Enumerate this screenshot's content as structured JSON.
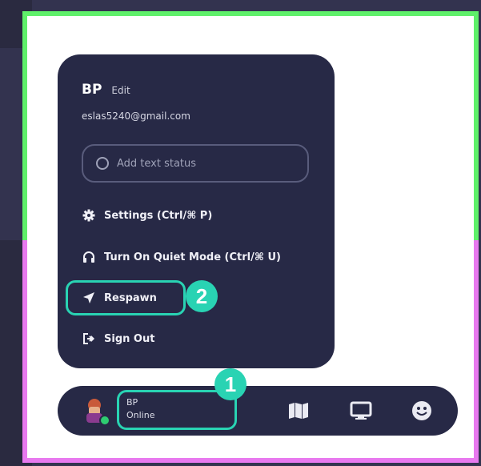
{
  "profile_menu": {
    "user_name": "BP",
    "edit_label": "Edit",
    "email": "eslas5240@gmail.com",
    "status_placeholder": "Add text status",
    "items": [
      {
        "label": "Settings (Ctrl/⌘ P)",
        "icon": "gear-icon"
      },
      {
        "label": "Turn On Quiet Mode (Ctrl/⌘ U)",
        "icon": "headphones-icon"
      },
      {
        "label": "Respawn",
        "icon": "location-arrow-icon"
      },
      {
        "label": "Sign Out",
        "icon": "sign-out-icon"
      }
    ]
  },
  "bottom_bar": {
    "user_name": "BP",
    "status": "Online",
    "icons": [
      "map-icon",
      "screen-share-icon",
      "emoji-icon"
    ]
  },
  "annotations": {
    "step_1": "1",
    "step_2": "2"
  },
  "colors": {
    "panel_bg": "#272946",
    "highlight": "#29d3b3",
    "frame_top": "#5ff06a",
    "frame_bottom": "#e879ef",
    "online": "#2ecc71"
  }
}
